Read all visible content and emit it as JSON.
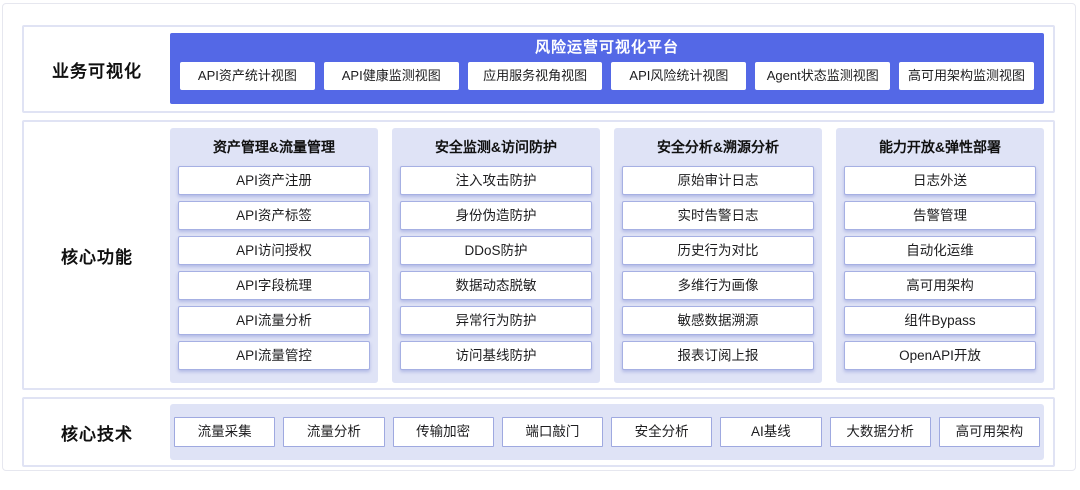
{
  "colors": {
    "accent_purple": "#5468e6",
    "panel_lavender": "#dfe3f6",
    "item_border": "#a6b0e3",
    "band_border": "#e0e3f4"
  },
  "sections": {
    "business_visualization": {
      "label": "业务可视化",
      "platform": {
        "title": "风险运营可视化平台",
        "views": [
          "API资产统计视图",
          "API健康监测视图",
          "应用服务视角视图",
          "API风险统计视图",
          "Agent状态监测视图",
          "高可用架构监测视图"
        ]
      }
    },
    "core_functions": {
      "label": "核心功能",
      "columns": [
        {
          "title": "资产管理&流量管理",
          "items": [
            "API资产注册",
            "API资产标签",
            "API访问授权",
            "API字段梳理",
            "API流量分析",
            "API流量管控"
          ]
        },
        {
          "title": "安全监测&访问防护",
          "items": [
            "注入攻击防护",
            "身份伪造防护",
            "DDoS防护",
            "数据动态脱敏",
            "异常行为防护",
            "访问基线防护"
          ]
        },
        {
          "title": "安全分析&溯源分析",
          "items": [
            "原始审计日志",
            "实时告警日志",
            "历史行为对比",
            "多维行为画像",
            "敏感数据溯源",
            "报表订阅上报"
          ]
        },
        {
          "title": "能力开放&弹性部署",
          "items": [
            "日志外送",
            "告警管理",
            "自动化运维",
            "高可用架构",
            "组件Bypass",
            "OpenAPI开放"
          ]
        }
      ]
    },
    "core_technology": {
      "label": "核心技术",
      "items": [
        "流量采集",
        "流量分析",
        "传输加密",
        "端口敲门",
        "安全分析",
        "AI基线",
        "大数据分析",
        "高可用架构"
      ]
    }
  }
}
